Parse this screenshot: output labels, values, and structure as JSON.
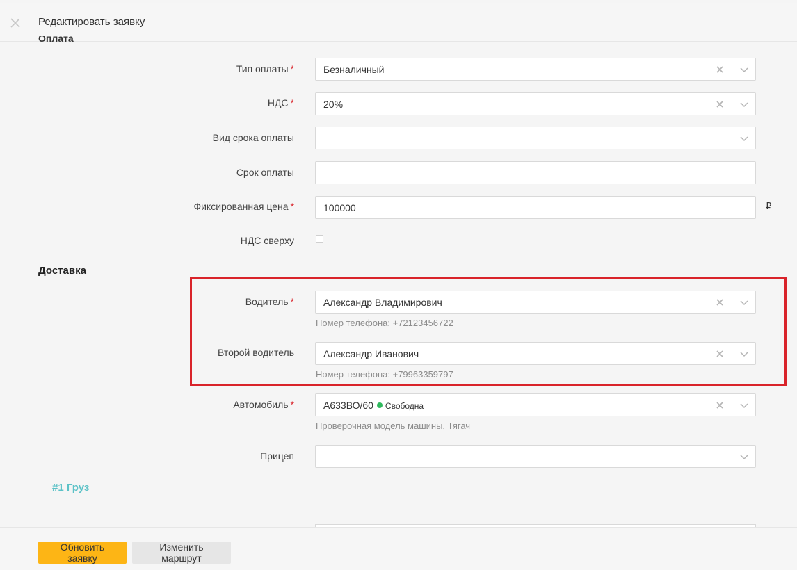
{
  "header": {
    "title": "Редактировать заявку"
  },
  "payment_section": {
    "title_partial": "Оплата"
  },
  "fields": {
    "payment_type": {
      "label": "Тип оплаты",
      "value": "Безналичный"
    },
    "vat": {
      "label": "НДС",
      "value": "20%"
    },
    "payment_term_type": {
      "label": "Вид срока оплаты",
      "value": ""
    },
    "payment_term": {
      "label": "Срок оплаты",
      "value": ""
    },
    "fixed_price": {
      "label": "Фиксированная цена",
      "value": "100000",
      "currency": "₽"
    },
    "vat_on_top": {
      "label": "НДС сверху",
      "checked": false
    }
  },
  "delivery": {
    "title": "Доставка",
    "driver": {
      "label": "Водитель",
      "value": "Александр Владимирович",
      "hint": "Номер телефона: +72123456722"
    },
    "second_driver": {
      "label": "Второй водитель",
      "value": "Александр Иванович",
      "hint": "Номер телефона: +79963359797"
    },
    "vehicle": {
      "label": "Автомобиль",
      "value": "А633ВО/60",
      "status": "Свободна",
      "status_color": "#2eb85c",
      "hint": "Проверочная модель машины, Тягач"
    },
    "trailer": {
      "label": "Прицеп",
      "value": ""
    }
  },
  "cargo": {
    "link": "#1 Груз"
  },
  "footer": {
    "update_button": "Обновить заявку",
    "change_route_button": "Изменить маршрут"
  },
  "colors": {
    "required": "#d9232a",
    "primary_button": "#fdb515",
    "highlight": "#d9232a",
    "cargo_link": "#5cc2c7"
  }
}
